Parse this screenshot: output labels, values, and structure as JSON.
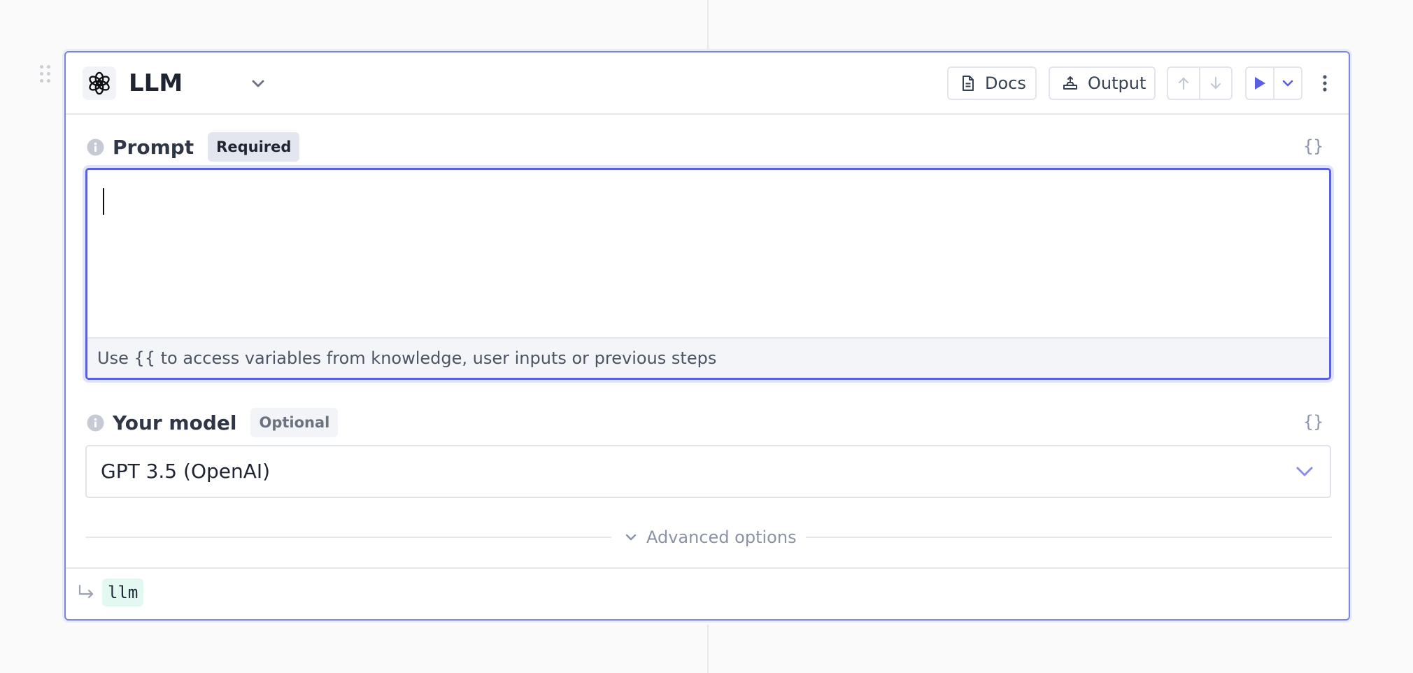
{
  "step": {
    "title": "LLM",
    "logo_icon": "openai-logo-icon",
    "actions": {
      "docs_label": "Docs",
      "output_label": "Output"
    }
  },
  "fields": {
    "prompt": {
      "label": "Prompt",
      "badge": "Required",
      "value": "",
      "hint": "Use {{ to access variables from knowledge, user inputs or previous steps",
      "variable_toggle": "{}"
    },
    "model": {
      "label": "Your model",
      "badge": "Optional",
      "selected": "GPT 3.5 (OpenAI)",
      "variable_toggle": "{}"
    }
  },
  "advanced": {
    "label": "Advanced options"
  },
  "output_var": {
    "name": "llm"
  },
  "colors": {
    "accent": "#5a62d9",
    "run_icon": "#5b5fe0",
    "output_chip_bg": "#e2f8f1"
  }
}
